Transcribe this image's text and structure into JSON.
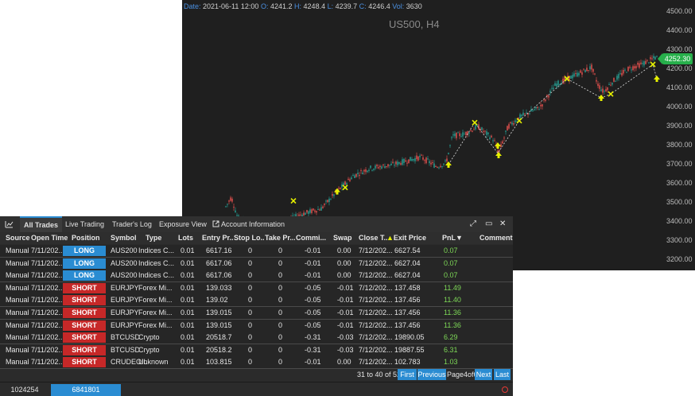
{
  "chart": {
    "ohlc": {
      "date_label": "Date:",
      "date": "2021-06-11 12:00",
      "o_label": "O:",
      "o": "4241.2",
      "h_label": "H:",
      "h": "4248.4",
      "l_label": "L:",
      "l": "4239.7",
      "c_label": "C:",
      "c": "4246.4",
      "vol_label": "Vol:",
      "vol": "3630"
    },
    "symbol": "US500, H4",
    "y_ticks": [
      "4500.00",
      "4400.00",
      "4300.00",
      "4200.00",
      "4100.00",
      "4000.00",
      "3900.00",
      "3800.00",
      "3700.00",
      "3600.00",
      "3500.00",
      "3400.00",
      "3300.00",
      "3200.00"
    ],
    "y_range": [
      3200,
      4500
    ],
    "current_price": "4252.30",
    "colors": {
      "up": "#26a69a",
      "down": "#ef5350",
      "marker": "#e6f000",
      "price_tag": "#27b04b"
    }
  },
  "panel": {
    "tabs": [
      {
        "label": "All Trades",
        "active": true
      },
      {
        "label": "Live Trading"
      },
      {
        "label": "Trader's Log"
      },
      {
        "label": "Exposure View"
      },
      {
        "label": "Account Information"
      }
    ],
    "columns": [
      "Source",
      "Open Time",
      "Position",
      "Symbol",
      "Type",
      "Lots",
      "Entry Pr...",
      "Stop Lo...",
      "Take Pr...",
      "Commi...",
      "Swap",
      "Close T...",
      "Exit Price",
      "PnL",
      "Comment"
    ],
    "rows": [
      [
        "Manual",
        "7/11/202...",
        "LONG",
        "AUS200",
        "Indices C...",
        "0.01",
        "6617.16",
        "0",
        "0",
        "-0.01",
        "0.00",
        "7/12/202...",
        "6627.54",
        "0.07"
      ],
      [
        "Manual",
        "7/11/202...",
        "LONG",
        "AUS200",
        "Indices C...",
        "0.01",
        "6617.06",
        "0",
        "0",
        "-0.01",
        "0.00",
        "7/12/202...",
        "6627.04",
        "0.07"
      ],
      [
        "Manual",
        "7/11/202...",
        "LONG",
        "AUS200",
        "Indices C...",
        "0.01",
        "6617.06",
        "0",
        "0",
        "-0.01",
        "0.00",
        "7/12/202...",
        "6627.04",
        "0.07"
      ],
      [
        "Manual",
        "7/11/202...",
        "SHORT",
        "EURJPY",
        "Forex Mi...",
        "0.01",
        "139.033",
        "0",
        "0",
        "-0.05",
        "-0.01",
        "7/12/202...",
        "137.458",
        "11.49"
      ],
      [
        "Manual",
        "7/11/202...",
        "SHORT",
        "EURJPY",
        "Forex Mi...",
        "0.01",
        "139.02",
        "0",
        "0",
        "-0.05",
        "-0.01",
        "7/12/202...",
        "137.456",
        "11.40"
      ],
      [
        "Manual",
        "7/11/202...",
        "SHORT",
        "EURJPY",
        "Forex Mi...",
        "0.01",
        "139.015",
        "0",
        "0",
        "-0.05",
        "-0.01",
        "7/12/202...",
        "137.456",
        "11.36"
      ],
      [
        "Manual",
        "7/11/202...",
        "SHORT",
        "EURJPY",
        "Forex Mi...",
        "0.01",
        "139.015",
        "0",
        "0",
        "-0.05",
        "-0.01",
        "7/12/202...",
        "137.456",
        "11.36"
      ],
      [
        "Manual",
        "7/11/202...",
        "SHORT",
        "BTCUSD",
        "Crypto",
        "0.01",
        "20518.7",
        "0",
        "0",
        "-0.31",
        "-0.03",
        "7/12/202...",
        "19890.05",
        "6.29"
      ],
      [
        "Manual",
        "7/11/202...",
        "SHORT",
        "BTCUSD",
        "Crypto",
        "0.01",
        "20518.2",
        "0",
        "0",
        "-0.31",
        "-0.03",
        "7/12/202...",
        "19887.55",
        "6.31"
      ],
      [
        "Manual",
        "7/11/202...",
        "SHORT",
        "CRUDEOIL",
        "Unknown",
        "0.01",
        "103.815",
        "0",
        "0",
        "-0.01",
        "0.00",
        "7/12/202...",
        "102.783",
        "1.03"
      ]
    ],
    "pager": {
      "range": "31 to 40 of 52",
      "first": "First",
      "previous": "Previous",
      "page": "Page4of6",
      "next": "Next",
      "last": "Last"
    },
    "accounts": [
      "1024254",
      "6841801"
    ]
  }
}
